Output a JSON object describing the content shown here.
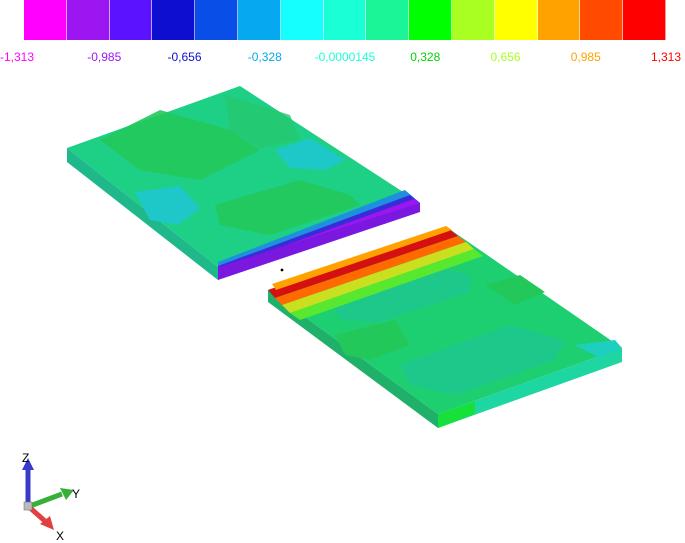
{
  "legend": {
    "colors": [
      "#ff00ff",
      "#9b16f0",
      "#5b12ff",
      "#0d0ecf",
      "#0a4ee8",
      "#06a8ef",
      "#15ffff",
      "#1bffd6",
      "#1bf598",
      "#00ff00",
      "#a8ff21",
      "#ffff00",
      "#ffa200",
      "#ff4a00",
      "#ff0000"
    ],
    "ticks": [
      {
        "label": "-1,313",
        "color": "#ff00ff"
      },
      {
        "label": "-0,985",
        "color": "#9b16f0"
      },
      {
        "label": "-0,656",
        "color": "#0d0ecf"
      },
      {
        "label": "-0,328",
        "color": "#06a8ef"
      },
      {
        "label": "-0,0000145",
        "color": "#1bffd6"
      },
      {
        "label": "0,328",
        "color": "#00d200"
      },
      {
        "label": "0,656",
        "color": "#a8ff21"
      },
      {
        "label": "0,985",
        "color": "#ffa200"
      },
      {
        "label": "1,313",
        "color": "#ff0000"
      }
    ]
  },
  "triad": {
    "z_label": "Z",
    "y_label": "Y",
    "x_label": "X"
  }
}
